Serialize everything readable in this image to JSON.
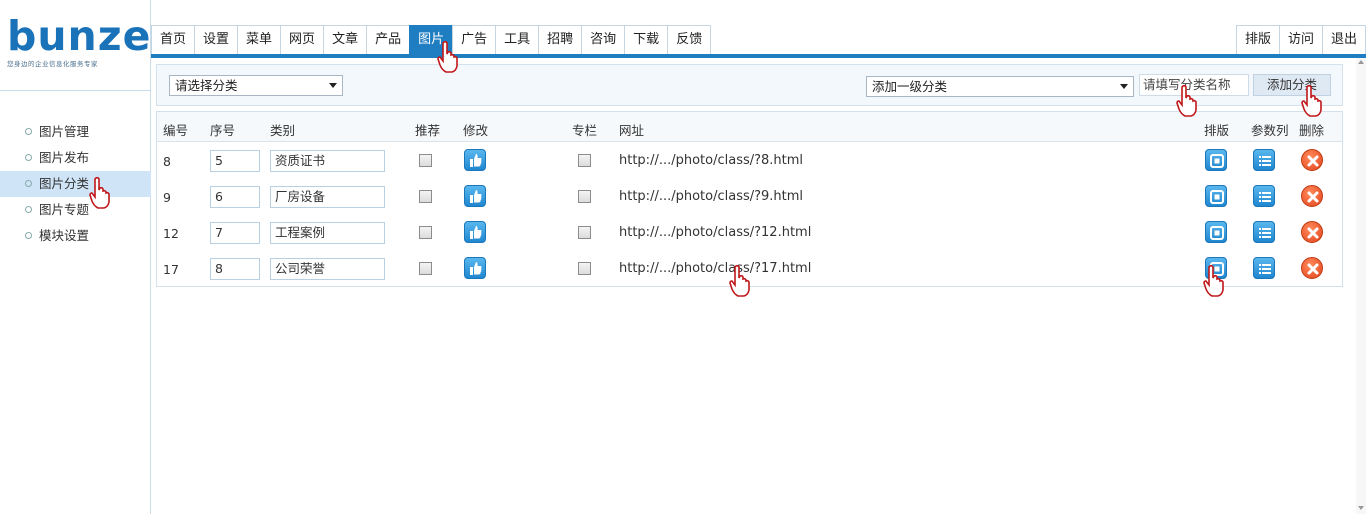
{
  "brand": {
    "logo_text": "bunze",
    "tagline": "您身边的企业信息化服务专家",
    "color": "#1a72b9"
  },
  "topnav": {
    "tabs": [
      "首页",
      "设置",
      "菜单",
      "网页",
      "文章",
      "产品",
      "图片",
      "广告",
      "工具",
      "招聘",
      "咨询",
      "下载",
      "反馈"
    ],
    "active_tab": "图片",
    "right_tabs": [
      "排版",
      "访问",
      "退出"
    ],
    "accent": "#1f7dc1"
  },
  "sidebar": {
    "items": [
      {
        "label": "图片管理"
      },
      {
        "label": "图片发布"
      },
      {
        "label": "图片分类"
      },
      {
        "label": "图片专题"
      },
      {
        "label": "模块设置"
      }
    ],
    "active_label": "图片分类"
  },
  "toolbar": {
    "category_select": "请选择分类",
    "level_select": "添加一级分类",
    "name_placeholder": "请填写分类名称",
    "add_button": "添加分类"
  },
  "table": {
    "headers": [
      "编号",
      "序号",
      "类别",
      "推荐",
      "修改",
      "专栏",
      "网址",
      "排版",
      "参数列",
      "删除"
    ],
    "rows": [
      {
        "id": "8",
        "order": "5",
        "name": "资质证书",
        "url": "http://.../photo/class/?8.html"
      },
      {
        "id": "9",
        "order": "6",
        "name": "厂房设备",
        "url": "http://.../photo/class/?9.html"
      },
      {
        "id": "12",
        "order": "7",
        "name": "工程案例",
        "url": "http://.../photo/class/?12.html"
      },
      {
        "id": "17",
        "order": "8",
        "name": "公司荣誉",
        "url": "http://.../photo/class/?17.html"
      }
    ]
  },
  "icons": {
    "edit": "thumbs-up-icon",
    "layout": "layout-icon",
    "params": "list-icon",
    "delete": "delete-icon"
  }
}
